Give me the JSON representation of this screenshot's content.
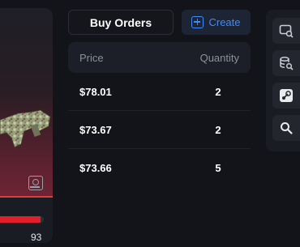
{
  "item": {
    "wear_value": "93",
    "wear_fraction": 0.93,
    "accent_color": "#e01f2a"
  },
  "tabs": {
    "buy_orders_label": "Buy Orders",
    "create_label": "Create",
    "create_icon": "plus-square-icon"
  },
  "orders": {
    "headers": {
      "price": "Price",
      "quantity": "Quantity"
    },
    "rows": [
      {
        "price": "$78.01",
        "quantity": "2"
      },
      {
        "price": "$73.67",
        "quantity": "2"
      },
      {
        "price": "$73.66",
        "quantity": "5"
      }
    ]
  },
  "sidebar": {
    "icons": [
      "inspect-in-game-icon",
      "database-search-icon",
      "steam-icon",
      "search-icon"
    ]
  },
  "colors": {
    "background": "#12141a",
    "panel": "#1a1c23",
    "accent_blue": "#3d8bff",
    "accent_red": "#e01f2a"
  }
}
